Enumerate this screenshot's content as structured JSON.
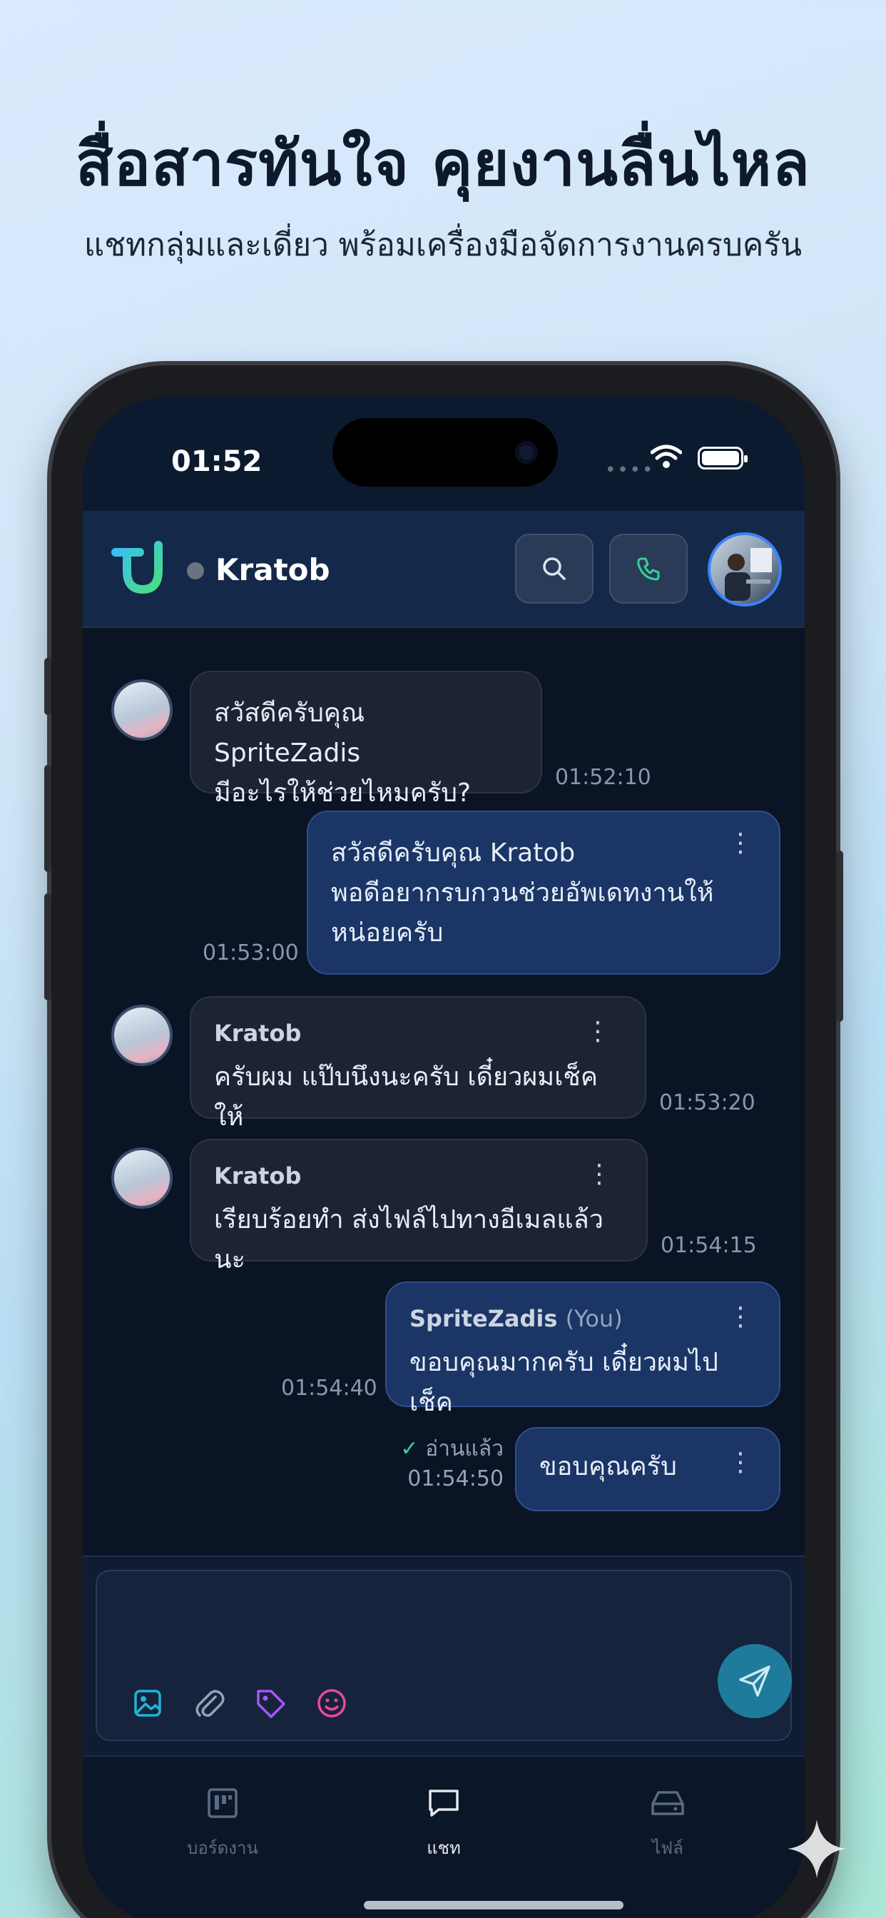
{
  "hero": {
    "title": "สื่อสารทันใจ คุยงานลื่นไหล",
    "subtitle": "แชทกลุ่มและเดี่ยว พร้อมเครื่องมือจัดการงานครบครัน"
  },
  "status_bar": {
    "time": "01:52",
    "signal_dots": "••••"
  },
  "app_bar": {
    "contact_name": "Kratob",
    "presence": "offline",
    "accent_color": "#3b82f6"
  },
  "messages": [
    {
      "direction": "in",
      "sender": "",
      "text_lines": [
        "สวัสดีครับคุณ SpriteZadis",
        "มีอะไรให้ช่วยไหมครับ?"
      ],
      "time": "01:52:10"
    },
    {
      "direction": "out",
      "sender": "",
      "text_lines": [
        "สวัสดีครับคุณ Kratob",
        "พอดีอยากรบกวนช่วยอัพเดทงานให้",
        "หน่อยครับ"
      ],
      "time": "01:53:00"
    },
    {
      "direction": "in",
      "sender": "Kratob",
      "text_lines": [
        "ครับผม แป๊บนึงนะครับ เดี๋ยวผมเช็คให้"
      ],
      "time": "01:53:20"
    },
    {
      "direction": "in",
      "sender": "Kratob",
      "text_lines": [
        "เรียบร้อยทำ ส่งไฟล์ไปทางอีเมลแล้วนะ"
      ],
      "time": "01:54:15"
    },
    {
      "direction": "out",
      "sender": "SpriteZadis",
      "sender_suffix": "(You)",
      "text_lines": [
        "ขอบคุณมากครับ เดี๋ยวผมไปเช็ค"
      ],
      "time": "01:54:40"
    },
    {
      "direction": "out",
      "sender": "",
      "text_lines": [
        "ขอบคุณครับ"
      ],
      "time": "01:54:50",
      "read_label": "อ่านแล้ว"
    }
  ],
  "composer": {
    "placeholder": "",
    "tools": [
      "image-icon",
      "attachment-icon",
      "tag-icon",
      "emoji-icon"
    ],
    "send_color": "#1f7b9b"
  },
  "tabs": [
    {
      "label": "บอร์ดงาน",
      "icon": "board-icon",
      "active": false
    },
    {
      "label": "แชท",
      "icon": "chat-icon",
      "active": true
    },
    {
      "label": "ไฟล์",
      "icon": "drive-icon",
      "active": false
    }
  ]
}
